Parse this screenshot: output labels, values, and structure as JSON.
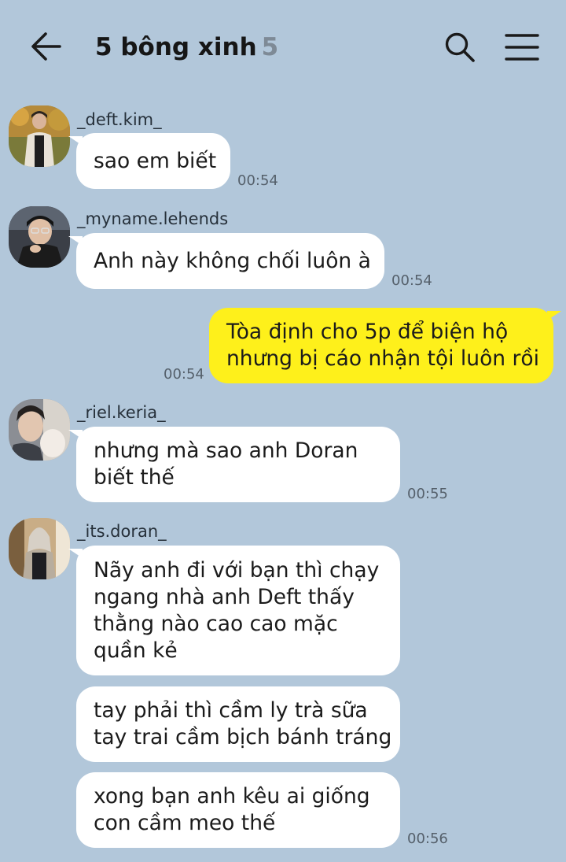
{
  "header": {
    "title": "5 bông xinh",
    "member_count": "5"
  },
  "colors": {
    "background": "#b2c7da",
    "my_bubble": "#fef01b",
    "their_bubble": "#ffffff"
  },
  "messages": [
    {
      "sender": "_deft.kim_",
      "lines": [
        "sao em biết"
      ],
      "time": "00:54"
    },
    {
      "sender": "_myname.lehends",
      "lines": [
        "Anh này không chối luôn à"
      ],
      "time": "00:54"
    },
    {
      "sender": "me",
      "lines": [
        "Tòa định cho 5p để biện hộ",
        "nhưng bị cáo nhận tội luôn rồi"
      ],
      "time": "00:54"
    },
    {
      "sender": "_riel.keria_",
      "lines": [
        "nhưng mà sao anh Doran",
        "biết thế"
      ],
      "time": "00:55"
    },
    {
      "sender": "_its.doran_",
      "lines": [
        "Nãy anh đi với bạn thì chạy",
        "ngang nhà anh Deft thấy",
        "thằng nào cao cao mặc",
        "quần kẻ"
      ]
    },
    {
      "sender": "_its.doran_",
      "lines": [
        "tay phải thì cầm ly trà sữa",
        "tay trai cầm bịch bánh tráng"
      ]
    },
    {
      "sender": "_its.doran_",
      "lines": [
        "xong bạn anh kêu ai giống",
        "con cầm meo thế"
      ],
      "time": "00:56"
    }
  ]
}
